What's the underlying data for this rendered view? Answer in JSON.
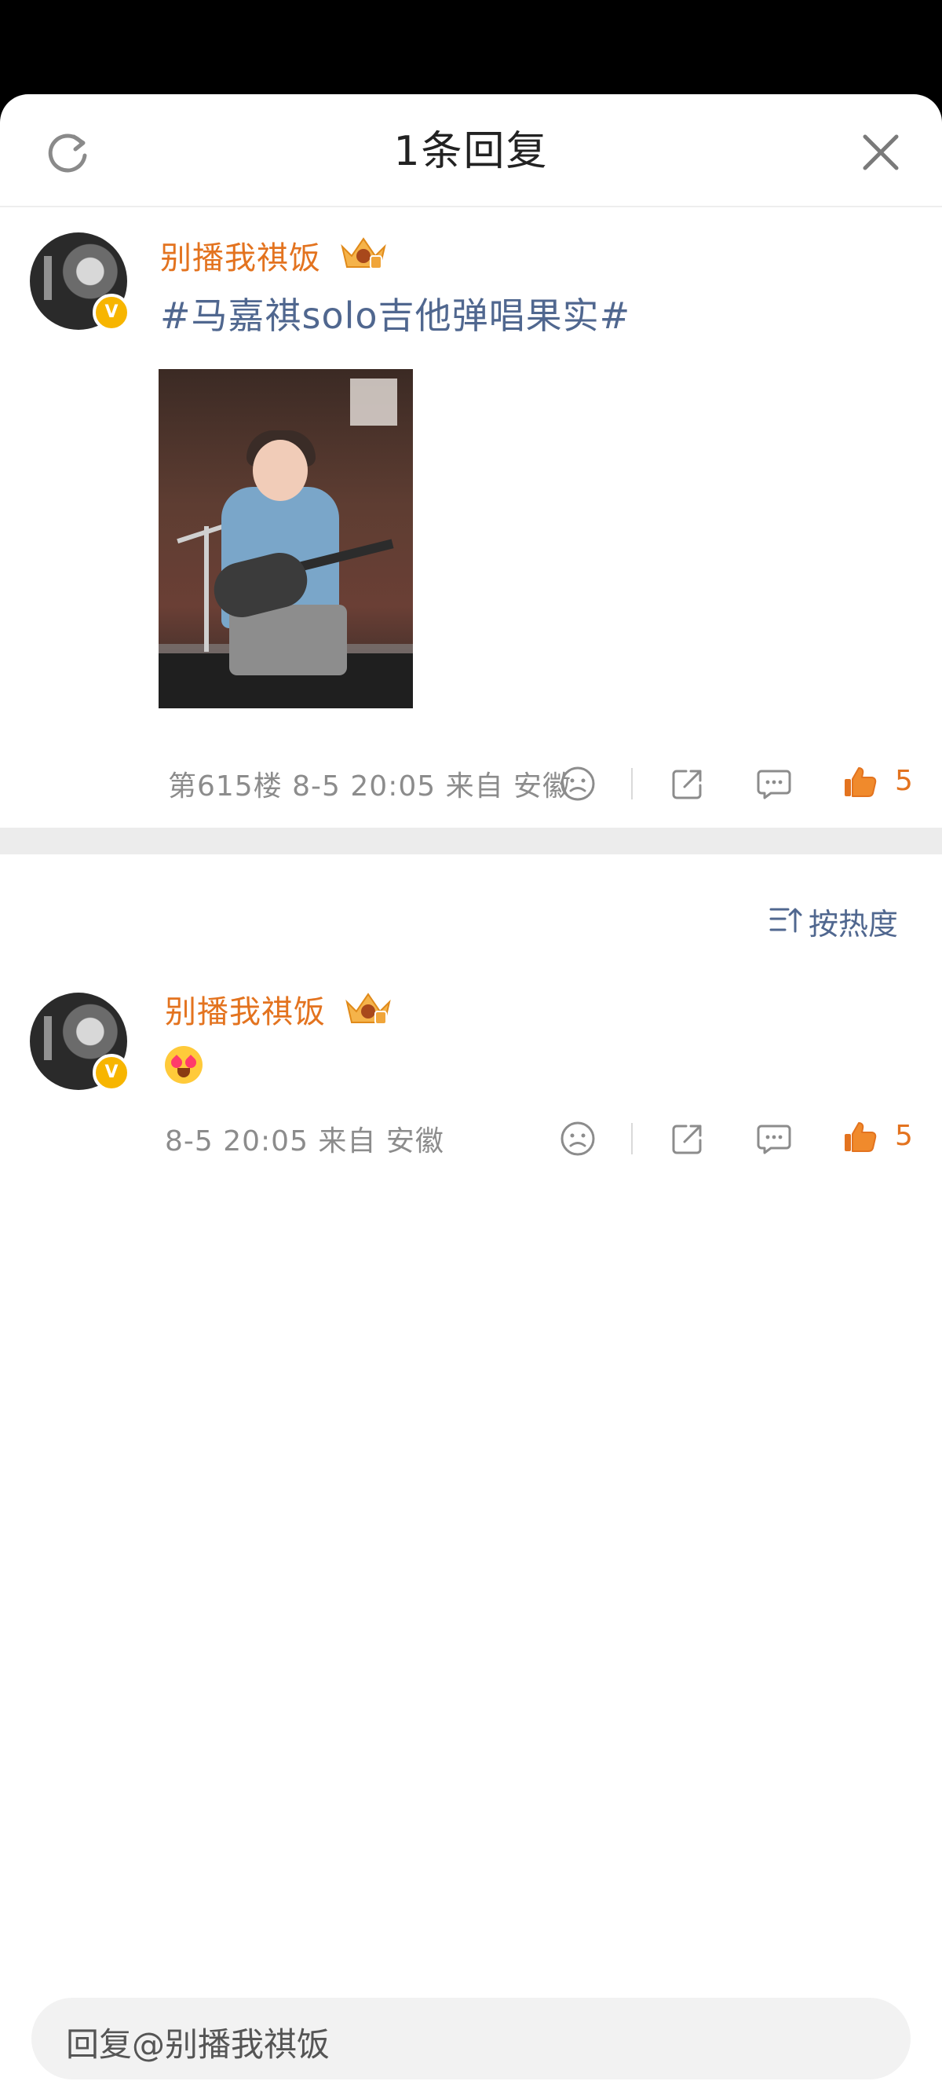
{
  "header": {
    "title": "1条回复"
  },
  "main_comment": {
    "username": "别播我祺饭",
    "topic": "#马嘉祺solo吉他弹唱果实#",
    "meta": "第615楼 8-5 20:05 来自 安徽",
    "likes": "5"
  },
  "sort": {
    "label": "按热度"
  },
  "reply": {
    "username": "别播我祺饭",
    "emoji_name": "heart-eyes-emoji",
    "meta": "8-5 20:05 来自 安徽",
    "likes": "5"
  },
  "input": {
    "placeholder": "回复@别播我祺饭"
  },
  "colors": {
    "accent": "#e3731f",
    "link": "#50678f",
    "muted": "#8c8c8c",
    "badge": "#f7b500"
  }
}
